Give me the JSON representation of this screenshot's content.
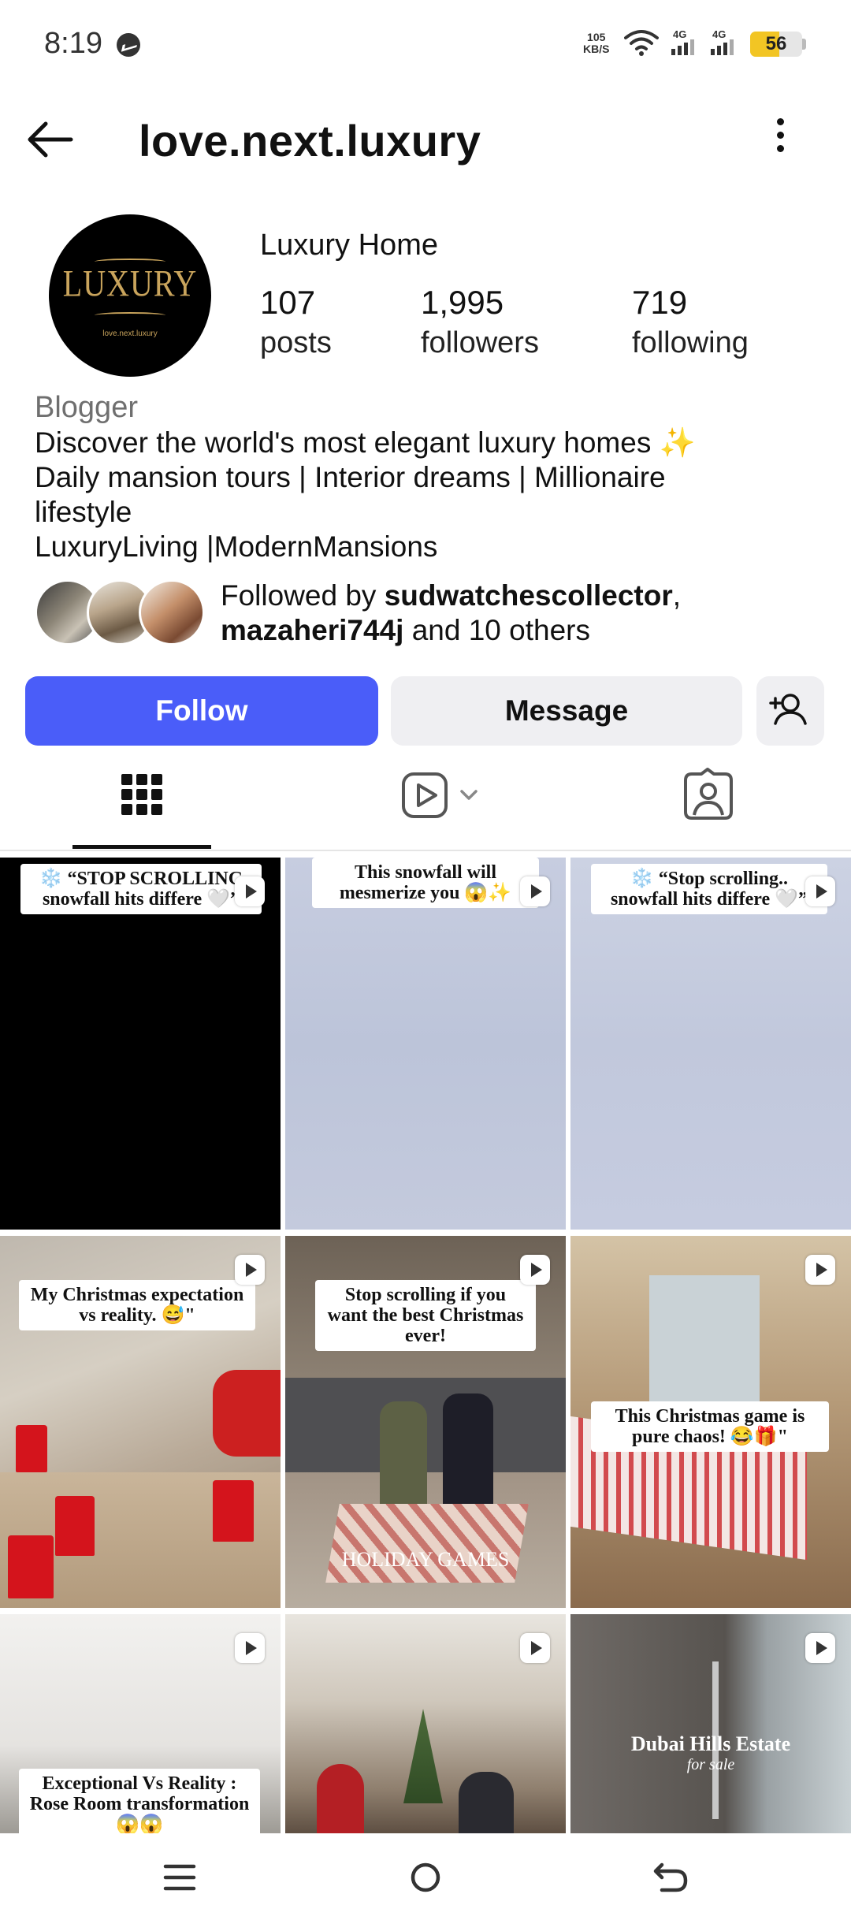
{
  "status_bar": {
    "time": "8:19",
    "messenger_icon": "messenger-icon",
    "net_speed_value": "105",
    "net_speed_unit": "KB/S",
    "signal1_label": "4G",
    "signal2_label": "4G",
    "battery": "56",
    "battery_color": "#f2c524"
  },
  "header": {
    "title": "love.next.luxury",
    "back_icon": "back-arrow-icon",
    "more_icon": "more-vertical-icon"
  },
  "profile": {
    "avatar_logo_text": "LUXURY",
    "avatar_logo_sub": "love.next.luxury",
    "display_name": "Luxury Home",
    "stats": [
      {
        "value": "107",
        "label": "posts"
      },
      {
        "value": "1,995",
        "label": "followers"
      },
      {
        "value": "719",
        "label": "following"
      }
    ],
    "category": "Blogger",
    "bio_lines": [
      "Discover the world's most elegant luxury homes ✨",
      "Daily mansion tours | Interior dreams | Millionaire",
      "lifestyle",
      "LuxuryLiving |ModernMansions"
    ],
    "followed_by": {
      "prefix": "Followed by ",
      "user1": "sudwatchescollector",
      "comma": ",",
      "user2": "mazaheri744j",
      "suffix": " and 10 others"
    }
  },
  "actions": {
    "follow": "Follow",
    "message": "Message",
    "add_user_icon": "add-user-icon",
    "accent_color": "#4a5df9"
  },
  "tabs": [
    {
      "icon": "grid-icon",
      "selected": true
    },
    {
      "icon": "reels-icon",
      "selected": false
    },
    {
      "icon": "tagged-icon",
      "selected": false
    }
  ],
  "posts": [
    {
      "caption": "❄️ “STOP SCROLLING snowfall hits differe 🤍”",
      "type": "reel"
    },
    {
      "caption": "This snowfall will mesmerize you 😱✨",
      "type": "reel"
    },
    {
      "caption": "❄️ “Stop scrolling.. snowfall hits differe 🤍”",
      "type": "reel"
    },
    {
      "caption": "My Christmas expectation vs reality. 😅\"",
      "type": "reel"
    },
    {
      "caption": "Stop scrolling if you want the best Christmas ever!",
      "overlay": "HOLIDAY GAMES",
      "type": "reel"
    },
    {
      "caption": "This Christmas game is pure chaos! 😂🎁\"",
      "type": "reel"
    },
    {
      "caption": "Exceptional Vs Reality : Rose Room transformation 😱😱",
      "type": "reel"
    },
    {
      "caption": "",
      "type": "reel"
    },
    {
      "caption": "Dubai Hills Estate",
      "overlay": "for sale",
      "type": "reel"
    }
  ],
  "navbar": {
    "items": [
      "menu-icon",
      "home-circle-icon",
      "back-nav-icon"
    ]
  }
}
